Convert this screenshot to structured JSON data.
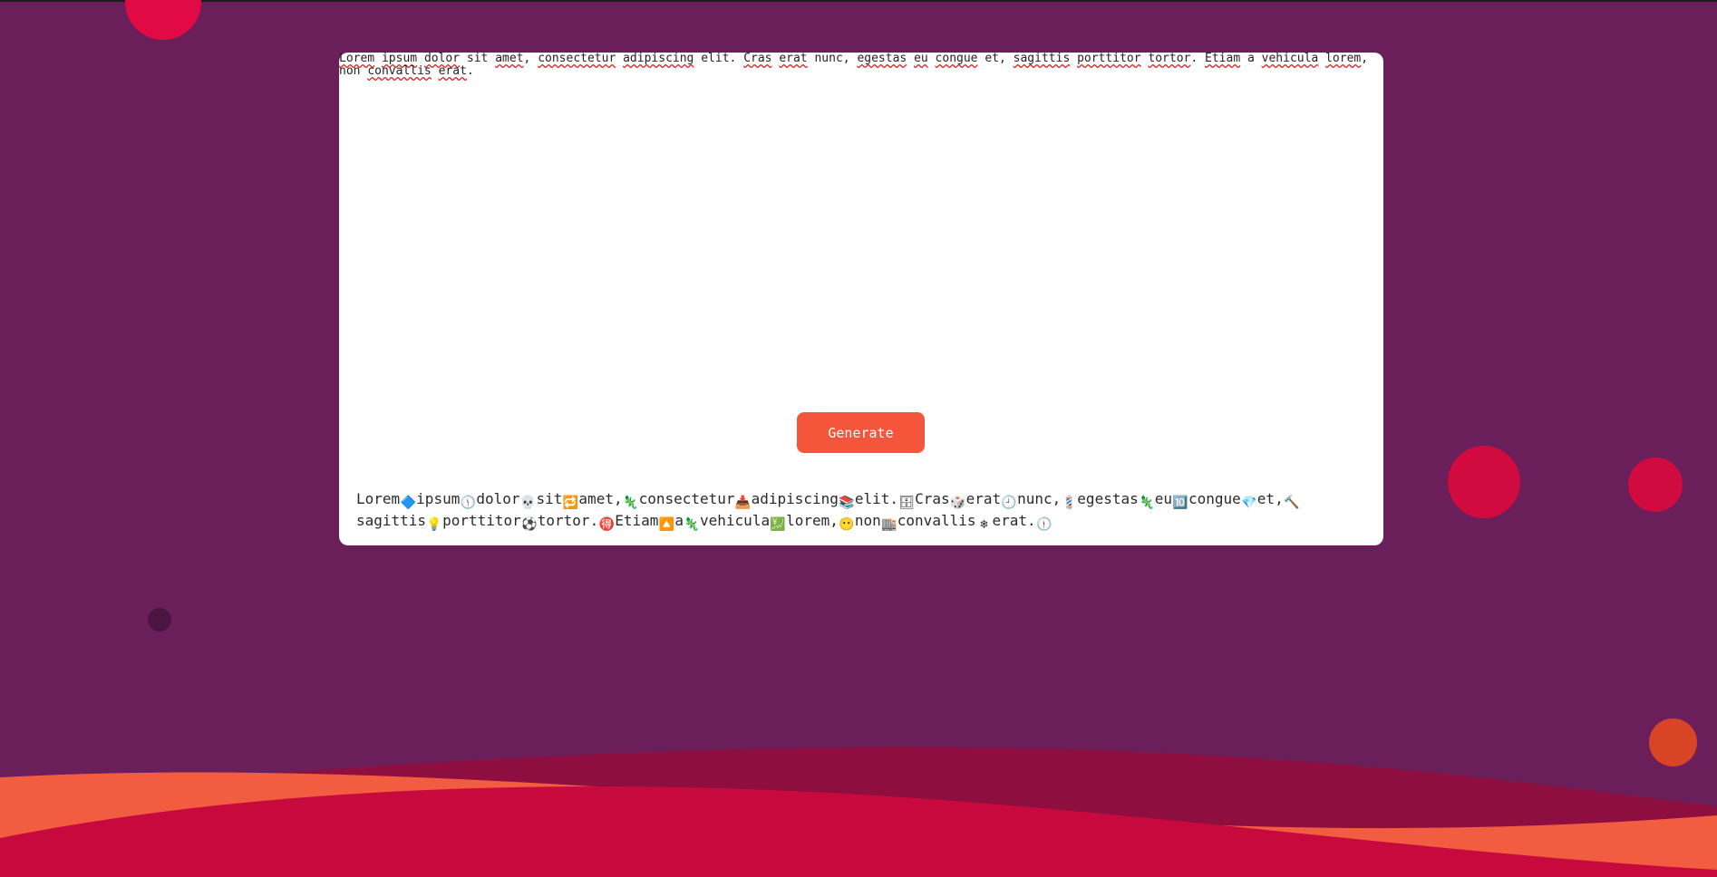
{
  "input": {
    "text": "Lorem ipsum dolor sit amet, consectetur adipiscing elit. Cras erat nunc, egestas eu congue et, sagittis porttitor tortor. Etiam a vehicula lorem, non convallis erat."
  },
  "generate_button": {
    "label": "Generate"
  },
  "output": {
    "tokens": [
      {
        "word": "Lorem",
        "emoji": "🔷"
      },
      {
        "word": "ipsum",
        "emoji": "🕦"
      },
      {
        "word": "dolor",
        "emoji": "💀"
      },
      {
        "word": "sit",
        "emoji": "🔁"
      },
      {
        "word": "amet,",
        "emoji": "🦎"
      },
      {
        "word": "consectetur",
        "emoji": "📥"
      },
      {
        "word": "adipiscing",
        "emoji": "📚"
      },
      {
        "word": "elit.",
        "emoji": "🗄"
      },
      {
        "word": "Cras",
        "emoji": "🎲"
      },
      {
        "word": "erat",
        "emoji": "🕘"
      },
      {
        "word": "nunc,",
        "emoji": "💈"
      },
      {
        "word": "egestas",
        "emoji": "🦎"
      },
      {
        "word": "eu",
        "emoji": "🔟"
      },
      {
        "word": "congue",
        "emoji": "💎"
      },
      {
        "word": "et,",
        "emoji": "🔨"
      },
      {
        "word": "sagittis",
        "emoji": "💡"
      },
      {
        "word": "porttitor",
        "emoji": "⚽"
      },
      {
        "word": "tortor.",
        "emoji": "🉐"
      },
      {
        "word": "Etiam",
        "emoji": "🔼"
      },
      {
        "word": "a",
        "emoji": "🦎"
      },
      {
        "word": "vehicula",
        "emoji": "💹"
      },
      {
        "word": "lorem,",
        "emoji": "😶"
      },
      {
        "word": "non",
        "emoji": "🏬"
      },
      {
        "word": "convallis",
        "emoji": "❄"
      },
      {
        "word": "erat.",
        "emoji": "🕦"
      }
    ]
  },
  "colors": {
    "background": "#6a1f5b",
    "button": "#f5553a",
    "card": "#ffffff",
    "wave_front": "#c8093e",
    "wave_back": "#8e0e3f",
    "wave_orange": "#f25c40",
    "bubble_red": "#d10a3f",
    "bubble_orange": "#d94426",
    "bubble_dark": "#4a1540"
  }
}
